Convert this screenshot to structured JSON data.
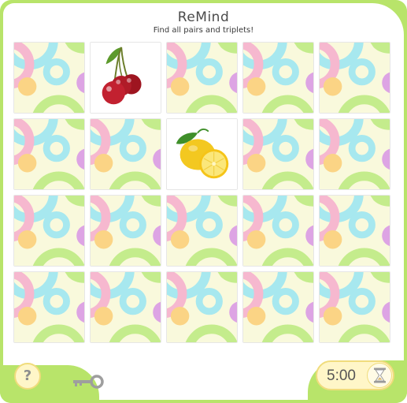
{
  "header": {
    "title": "ReMind",
    "subtitle": "Find all pairs and triplets!"
  },
  "board": {
    "rows": 4,
    "columns": 5,
    "cards": [
      {
        "state": "hidden"
      },
      {
        "state": "revealed",
        "fruit": "cherries"
      },
      {
        "state": "hidden"
      },
      {
        "state": "hidden"
      },
      {
        "state": "hidden"
      },
      {
        "state": "hidden"
      },
      {
        "state": "hidden"
      },
      {
        "state": "revealed",
        "fruit": "lemon"
      },
      {
        "state": "hidden"
      },
      {
        "state": "hidden"
      },
      {
        "state": "hidden"
      },
      {
        "state": "hidden"
      },
      {
        "state": "hidden"
      },
      {
        "state": "hidden"
      },
      {
        "state": "hidden"
      },
      {
        "state": "hidden"
      },
      {
        "state": "hidden"
      },
      {
        "state": "hidden"
      },
      {
        "state": "hidden"
      },
      {
        "state": "hidden"
      }
    ]
  },
  "footer": {
    "help_label": "?",
    "help_icon": "question-icon",
    "key_icon": "key-icon",
    "timer": "5:00",
    "timer_icon": "hourglass-icon"
  },
  "colors": {
    "frame": "#b8e46a",
    "card_back_base": "#f9f9dc",
    "card_back_pink": "#f6b8cf",
    "card_back_cyan": "#a7e8ef",
    "card_back_yellow": "#fbd485",
    "card_back_purple": "#dda4e4",
    "card_back_green": "#c4ec8c",
    "button_fill": "#fff6c8"
  }
}
